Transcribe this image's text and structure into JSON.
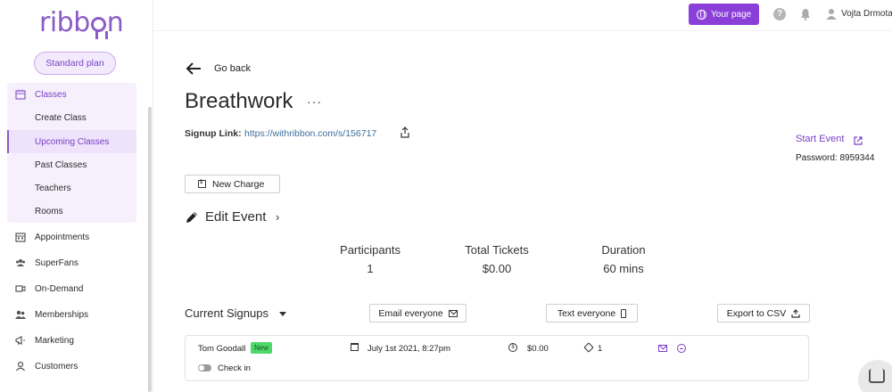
{
  "sidebar": {
    "logo": "ribbon",
    "plan": "Standard plan",
    "classes": {
      "label": "Classes",
      "sub_items": [
        {
          "label": "Create Class"
        },
        {
          "label": "Upcoming Classes"
        },
        {
          "label": "Past Classes"
        },
        {
          "label": "Teachers"
        },
        {
          "label": "Rooms"
        }
      ]
    },
    "items": [
      {
        "label": "Appointments",
        "icon": "calendar-grid-icon"
      },
      {
        "label": "SuperFans",
        "icon": "group-icon"
      },
      {
        "label": "On-Demand",
        "icon": "video-icon"
      },
      {
        "label": "Memberships",
        "icon": "users-icon"
      },
      {
        "label": "Marketing",
        "icon": "megaphone-icon"
      },
      {
        "label": "Customers",
        "icon": "customers-icon"
      }
    ]
  },
  "topbar": {
    "your_page": "Your page",
    "help": "?",
    "user_name": "Vojta Drmota"
  },
  "main": {
    "go_back": "Go back",
    "title": "Breathwork",
    "title_menu": "···",
    "signup_label": "Signup Link:",
    "signup_url": "https://withribbon.com/s/156717",
    "start_event": "Start Event",
    "password": "Password: 8959344",
    "new_charge": "New Charge",
    "edit_event": "Edit Event",
    "edit_chevron": "›",
    "stats": [
      {
        "label": "Participants",
        "value": "1"
      },
      {
        "label": "Total Tickets",
        "value": "$0.00"
      },
      {
        "label": "Duration",
        "value": "60 mins"
      }
    ],
    "current_signups": "Current Signups",
    "email_everyone": "Email everyone",
    "text_everyone": "Text everyone",
    "export_csv": "Export to CSV",
    "signups": [
      {
        "name": "Tom Goodall",
        "badge": "New",
        "date": "July 1st 2021, 8:27pm",
        "amount": "$0.00",
        "tickets": "1",
        "checkin_label": "Check in"
      }
    ]
  },
  "colors": {
    "accent": "#8b3fd9",
    "accent_text": "#7a3fc4",
    "link": "#3f6e9e",
    "badge_new": "#4fd86a"
  }
}
